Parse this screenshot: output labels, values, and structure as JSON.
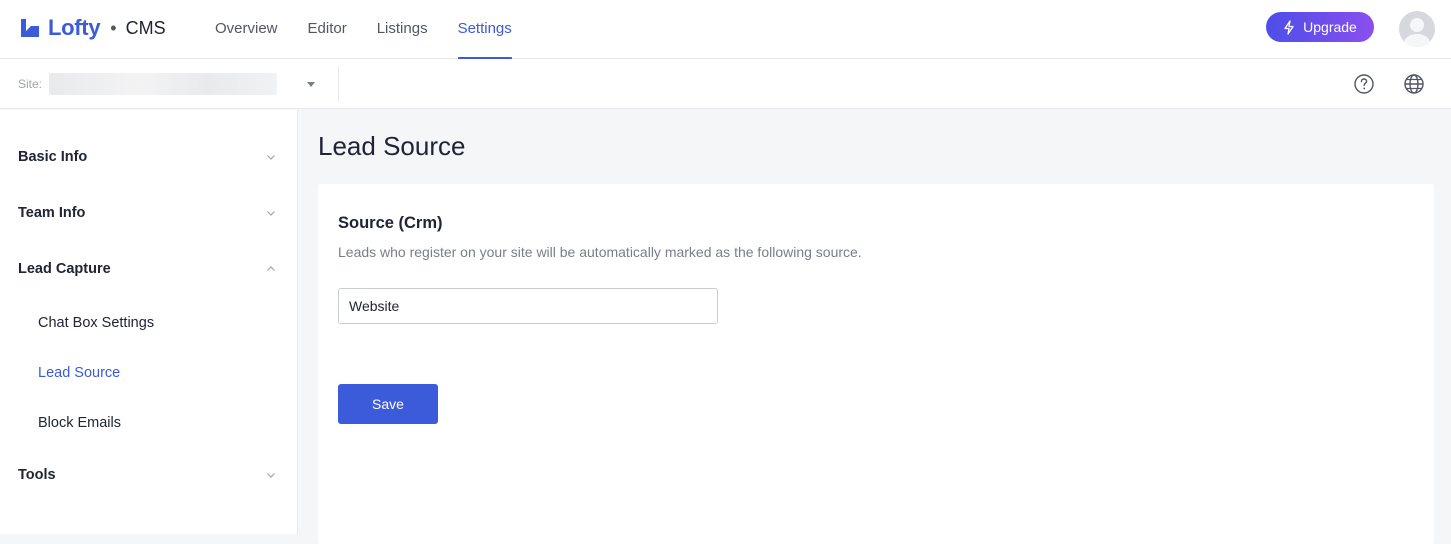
{
  "app": {
    "brand": "Lofty",
    "product": "CMS",
    "separator": "•"
  },
  "nav": {
    "items": [
      {
        "label": "Overview"
      },
      {
        "label": "Editor"
      },
      {
        "label": "Listings"
      },
      {
        "label": "Settings",
        "active": true
      }
    ]
  },
  "header": {
    "upgrade_label": "Upgrade"
  },
  "subbar": {
    "site_label": "Site:"
  },
  "sidebar": {
    "groups": [
      {
        "label": "Basic Info",
        "expanded": false
      },
      {
        "label": "Team Info",
        "expanded": false
      },
      {
        "label": "Lead Capture",
        "expanded": true,
        "items": [
          {
            "label": "Chat Box Settings"
          },
          {
            "label": "Lead Source",
            "active": true
          },
          {
            "label": "Block Emails"
          }
        ]
      },
      {
        "label": "Tools",
        "expanded": false
      }
    ]
  },
  "main": {
    "title": "Lead Source",
    "section_title": "Source (Crm)",
    "section_desc": "Leads who register on your site will be automatically marked as the following source.",
    "source_value": "Website",
    "save_label": "Save"
  },
  "colors": {
    "accent": "#3b5bdb",
    "upgrade_gradient_start": "#4d4ee8",
    "upgrade_gradient_end": "#8a4fee"
  }
}
